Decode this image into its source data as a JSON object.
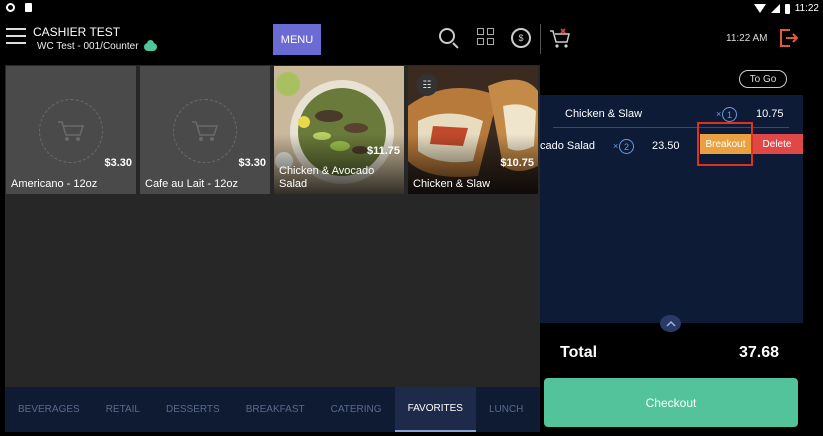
{
  "status_bar": {
    "time": "11:22"
  },
  "header": {
    "cashier": "CASHIER TEST",
    "store": "WC Test - 001/Counter",
    "menu_label": "MENU",
    "clock": "11:22 AM"
  },
  "products": [
    {
      "name": "Americano - 12oz",
      "price": "$3.30",
      "has_photo": false
    },
    {
      "name": "Cafe au Lait - 12oz",
      "price": "$3.30",
      "has_photo": false
    },
    {
      "name": "Chicken & Avocado Salad",
      "price": "$11.75",
      "has_photo": true
    },
    {
      "name": "Chicken & Slaw",
      "price": "$10.75",
      "has_photo": true,
      "icon": "tag"
    }
  ],
  "categories": [
    {
      "label": "BEVERAGES",
      "active": false
    },
    {
      "label": "RETAIL",
      "active": false
    },
    {
      "label": "DESSERTS",
      "active": false
    },
    {
      "label": "BREAKFAST",
      "active": false
    },
    {
      "label": "CATERING",
      "active": false
    },
    {
      "label": "FAVORITES",
      "active": true
    },
    {
      "label": "LUNCH",
      "active": false
    }
  ],
  "order": {
    "to_go_label": "To Go",
    "items": [
      {
        "name": "Chicken & Slaw",
        "qty": "1",
        "price": "10.75"
      },
      {
        "name": "cado Salad",
        "qty": "2",
        "price": "23.50"
      }
    ],
    "qty_prefix": "×",
    "breakout_label": "Breakout",
    "delete_label": "Delete",
    "total_label": "Total",
    "total_value": "37.68",
    "checkout_label": "Checkout"
  },
  "colors": {
    "menu_button": "#6b6bd6",
    "checkout": "#52c39a",
    "breakout": "#e8a040",
    "delete": "#e04848",
    "highlight": "#e03020",
    "order_panel": "#0d1b37"
  }
}
